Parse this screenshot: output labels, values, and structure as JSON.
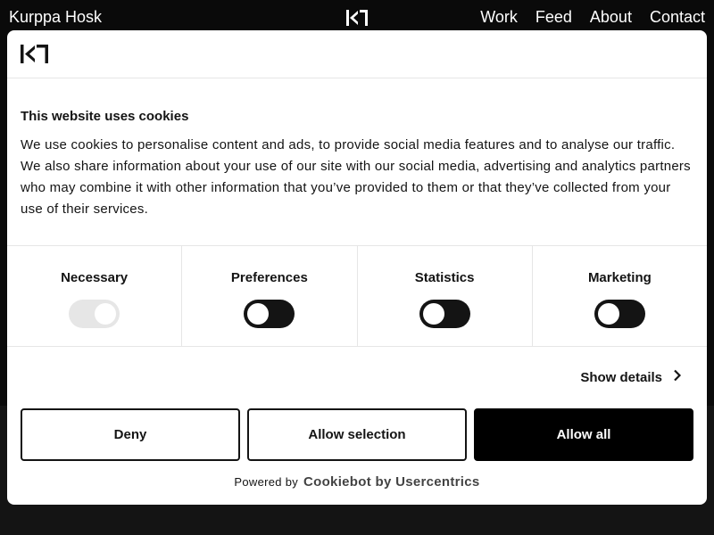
{
  "site": {
    "name": "Kurppa Hosk",
    "nav": [
      "Work",
      "Feed",
      "About",
      "Contact"
    ]
  },
  "dialog": {
    "title": "This website uses cookies",
    "body": "We use cookies to personalise content and ads, to provide social media features and to analyse our traffic. We also share information about your use of our site with our social media, advertising and analytics partners who may combine it with other information that you’ve provided to them or that they’ve collected from your use of their services.",
    "categories": [
      {
        "label": "Necessary",
        "checked": true,
        "disabled": true
      },
      {
        "label": "Preferences",
        "checked": false,
        "disabled": false
      },
      {
        "label": "Statistics",
        "checked": false,
        "disabled": false
      },
      {
        "label": "Marketing",
        "checked": false,
        "disabled": false
      }
    ],
    "show_details": "Show details",
    "buttons": {
      "deny": "Deny",
      "allow_selection": "Allow selection",
      "allow_all": "Allow all"
    },
    "powered_by": "Powered by",
    "powered_brand": "Cookiebot by Usercentrics"
  },
  "colors": {
    "page_bg": "#0a0a0a",
    "dialog_bg": "#ffffff",
    "accent": "#141414",
    "toggle_disabled": "#e6e6e6"
  },
  "icons": {
    "logo": "kurppa-hosk-logo",
    "details": "chevron-right-icon"
  }
}
